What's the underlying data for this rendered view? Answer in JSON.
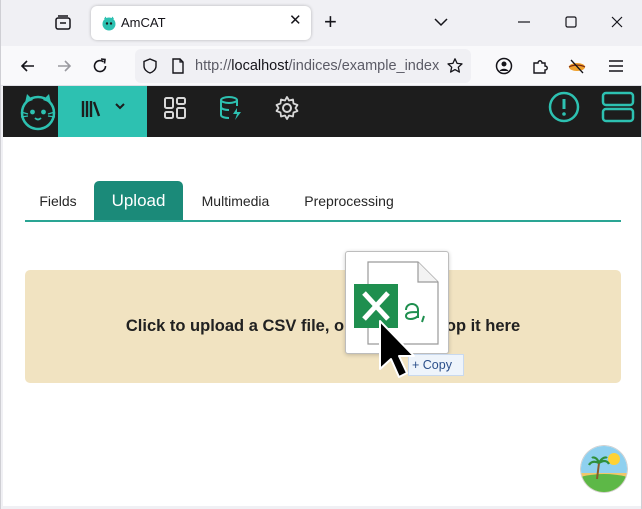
{
  "browser": {
    "tab_title": "AmCAT",
    "url_prefix": "http://",
    "url_host": "localhost",
    "url_path": "/indices/example_index/",
    "icons": {
      "tabs": "tab-list-icon",
      "close": "close-icon",
      "new_tab": "plus-icon",
      "list_all_tabs": "chevron-down-icon",
      "back": "back-arrow-icon",
      "forward": "forward-arrow-icon",
      "reload": "reload-icon",
      "shield": "tracking-protection-icon",
      "page": "page-icon",
      "bookmark": "star-icon",
      "account": "account-icon",
      "extensions": "puzzle-icon",
      "menu": "hamburger-icon"
    },
    "close_glyph": "✕",
    "new_tab_glyph": "+"
  },
  "app": {
    "nav_chevron": "⌄",
    "tabs": [
      {
        "label": "Fields",
        "active": false
      },
      {
        "label": "Upload",
        "active": true
      },
      {
        "label": "Multimedia",
        "active": false
      },
      {
        "label": "Preprocessing",
        "active": false
      }
    ],
    "upload_text": "Click to upload a CSV file, or drag and drop it here",
    "upload_text_visible_start": "Click to upload a CSV file, or",
    "upload_text_visible_end": "op it here",
    "drag_badge": "+ Copy",
    "colors": {
      "nav_bg": "#1d1d1d",
      "accent": "#2dc1b1",
      "tab_active": "#1b8a79",
      "dropzone": "#f1e3c1"
    }
  }
}
